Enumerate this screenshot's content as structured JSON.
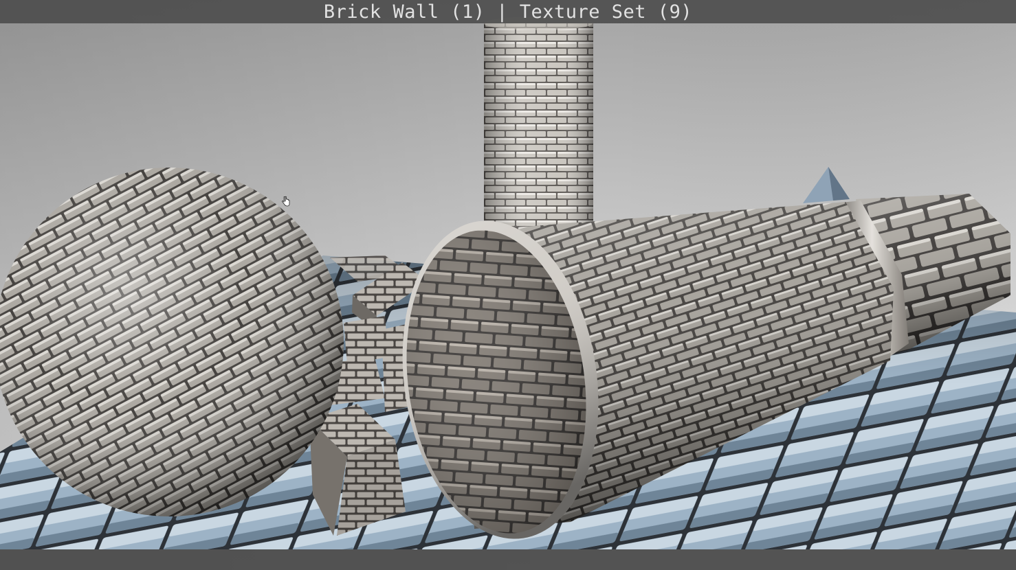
{
  "viewport": {
    "title": "Brick Wall (1) | Texture Set (9)",
    "cursor_icon": "hand-icon"
  },
  "colors": {
    "background_top": "#a9a9a9",
    "background_bottom": "#dcdcdc",
    "metal_light": "#e8e6e2",
    "metal_mid": "#9a968f",
    "metal_dark": "#4a4744",
    "floor_tile": "#9fb4c6",
    "floor_dark": "#2c3036",
    "title_bar": "#4a4a4a"
  }
}
